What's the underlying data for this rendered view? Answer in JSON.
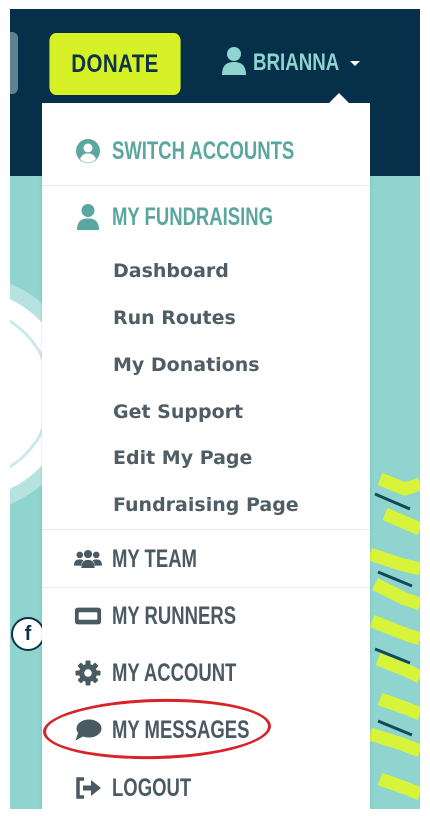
{
  "navbar": {
    "donate_label": "DONATE",
    "user_name": "BRIANNA"
  },
  "social": {
    "facebook_label": "f"
  },
  "dropdown": {
    "switch_accounts": "SWITCH ACCOUNTS",
    "my_fundraising": "MY FUNDRAISING",
    "fundraising_links": [
      "Dashboard",
      "Run Routes",
      "My Donations",
      "Get Support",
      "Edit My Page",
      "Fundraising Page"
    ],
    "my_team": "MY TEAM",
    "my_runners": "MY RUNNERS",
    "my_account": "MY ACCOUNT",
    "my_messages": "MY MESSAGES",
    "logout": "LOGOUT"
  },
  "colors": {
    "navbar_bg": "#06304a",
    "donate_bg": "#d6f227",
    "accent_teal": "#5aa7a0",
    "menu_text_dark": "#4a5a63",
    "background_teal": "#8fd4cf",
    "highlight_red": "#d8232a"
  },
  "icons": {
    "user": "user-icon",
    "switch_accounts": "user-circle-icon",
    "my_fundraising": "user-icon",
    "my_team": "users-icon",
    "my_runners": "id-card-icon",
    "my_account": "gear-icon",
    "my_messages": "comment-icon",
    "logout": "sign-out-icon"
  }
}
